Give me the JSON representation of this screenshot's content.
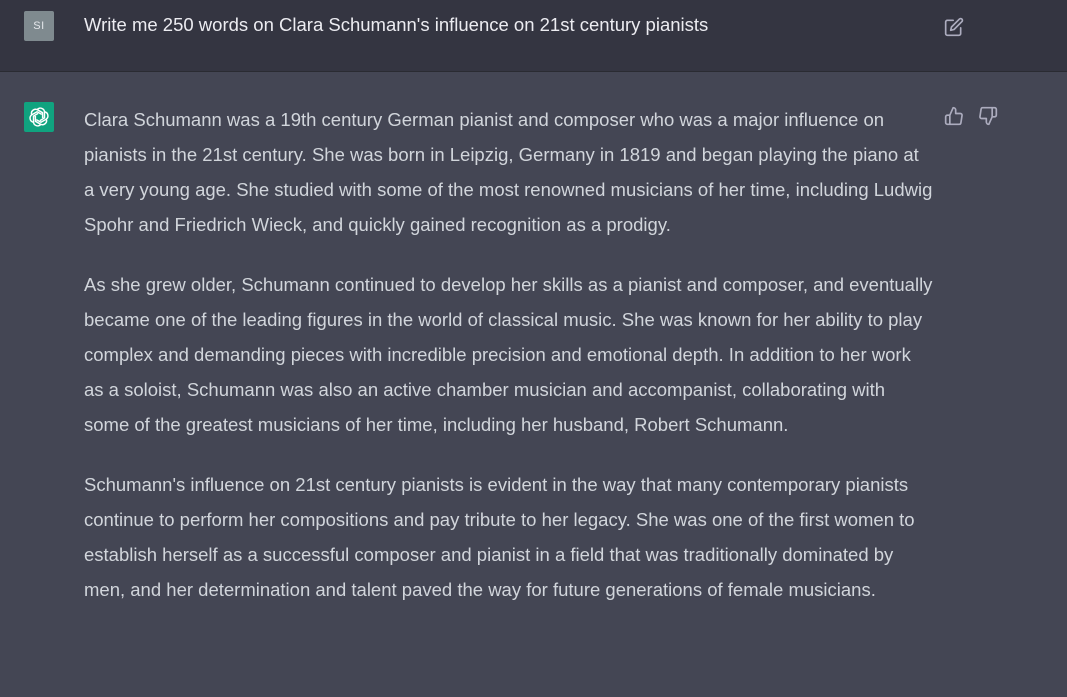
{
  "user": {
    "avatar_initials": "SI",
    "prompt": "Write me 250 words on Clara Schumann's influence on 21st century pianists",
    "edit_icon": "edit-icon"
  },
  "assistant": {
    "avatar_icon": "openai-logo-icon",
    "paragraphs": [
      "Clara Schumann was a 19th century German pianist and composer who was a major influence on pianists in the 21st century. She was born in Leipzig, Germany in 1819 and began playing the piano at a very young age. She studied with some of the most renowned musicians of her time, including Ludwig Spohr and Friedrich Wieck, and quickly gained recognition as a prodigy.",
      "As she grew older, Schumann continued to develop her skills as a pianist and composer, and eventually became one of the leading figures in the world of classical music. She was known for her ability to play complex and demanding pieces with incredible precision and emotional depth. In addition to her work as a soloist, Schumann was also an active chamber musician and accompanist, collaborating with some of the greatest musicians of her time, including her husband, Robert Schumann.",
      "Schumann's influence on 21st century pianists is evident in the way that many contemporary pianists continue to perform her compositions and pay tribute to her legacy. She was one of the first women to establish herself as a successful composer and pianist in a field that was traditionally dominated by men, and her determination and talent paved the way for future generations of female musicians."
    ],
    "feedback_icons": [
      "thumbs-up-icon",
      "thumbs-down-icon"
    ]
  },
  "colors": {
    "user_row_bg": "#343541",
    "assistant_row_bg": "#444654",
    "bot_avatar_bg": "#10a37f",
    "user_avatar_bg": "#7f8a8f"
  }
}
